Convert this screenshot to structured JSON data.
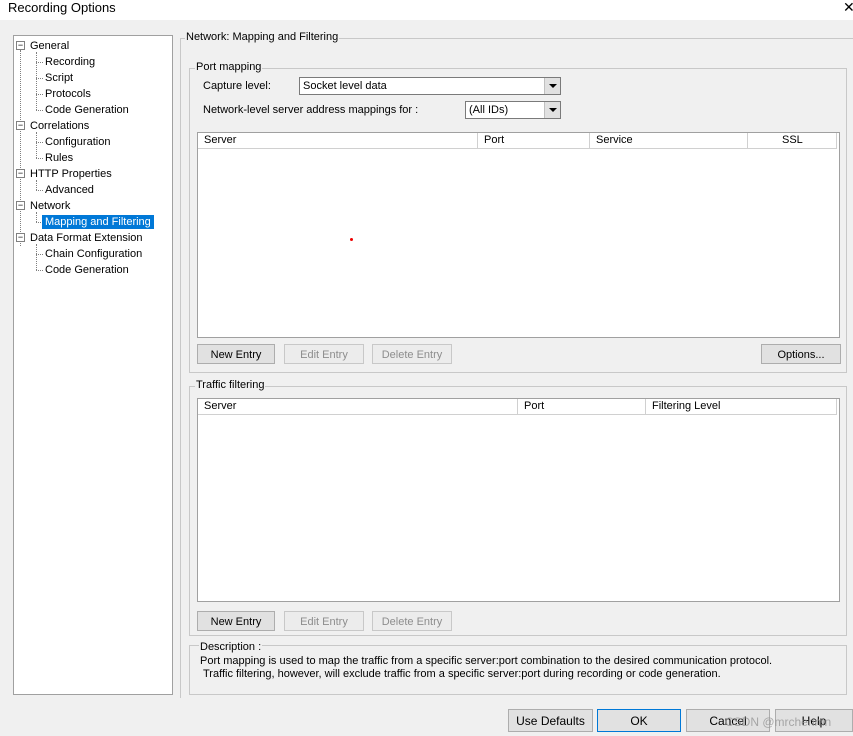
{
  "window": {
    "title": "Recording Options",
    "close_glyph": "✕"
  },
  "tree": {
    "expanded_glyph": "−",
    "nodes": [
      {
        "label": "General"
      },
      {
        "label": "Recording"
      },
      {
        "label": "Script"
      },
      {
        "label": "Protocols"
      },
      {
        "label": "Code Generation"
      },
      {
        "label": "Correlations"
      },
      {
        "label": "Configuration"
      },
      {
        "label": "Rules"
      },
      {
        "label": "HTTP Properties"
      },
      {
        "label": "Advanced"
      },
      {
        "label": "Network"
      },
      {
        "label": "Mapping and Filtering",
        "selected": true
      },
      {
        "label": "Data Format Extension"
      },
      {
        "label": "Chain Configuration"
      },
      {
        "label": "Code Generation"
      }
    ]
  },
  "panel": {
    "title": "Network: Mapping and Filtering"
  },
  "port_mapping": {
    "group_label": "Port mapping",
    "capture_label": "Capture level:",
    "capture_value": "Socket level data",
    "server_map_label": "Network-level server address mappings for :",
    "server_map_value": "(All IDs)",
    "columns": [
      "Server",
      "Port",
      "Service",
      "SSL"
    ],
    "buttons": {
      "new": "New Entry",
      "edit": "Edit Entry",
      "delete": "Delete Entry",
      "options": "Options..."
    }
  },
  "traffic_filtering": {
    "group_label": "Traffic filtering",
    "columns": [
      "Server",
      "Port",
      "Filtering Level"
    ],
    "buttons": {
      "new": "New Entry",
      "edit": "Edit Entry",
      "delete": "Delete Entry"
    }
  },
  "description": {
    "label": "Description :",
    "line1": "Port mapping is used to map the traffic from a specific server:port combination to the desired communication protocol.",
    "line2": "Traffic filtering, however, will exclude traffic from a specific server:port during recording or code generation."
  },
  "footer": {
    "use_defaults": "Use Defaults",
    "ok": "OK",
    "cancel": "Cancel",
    "help": "Help"
  },
  "watermark": "CSDN @mrchenmn",
  "colors": {
    "selection": "#0078d7",
    "dialog_bg": "#f0f0f0",
    "marker_dot": "#e00000"
  }
}
